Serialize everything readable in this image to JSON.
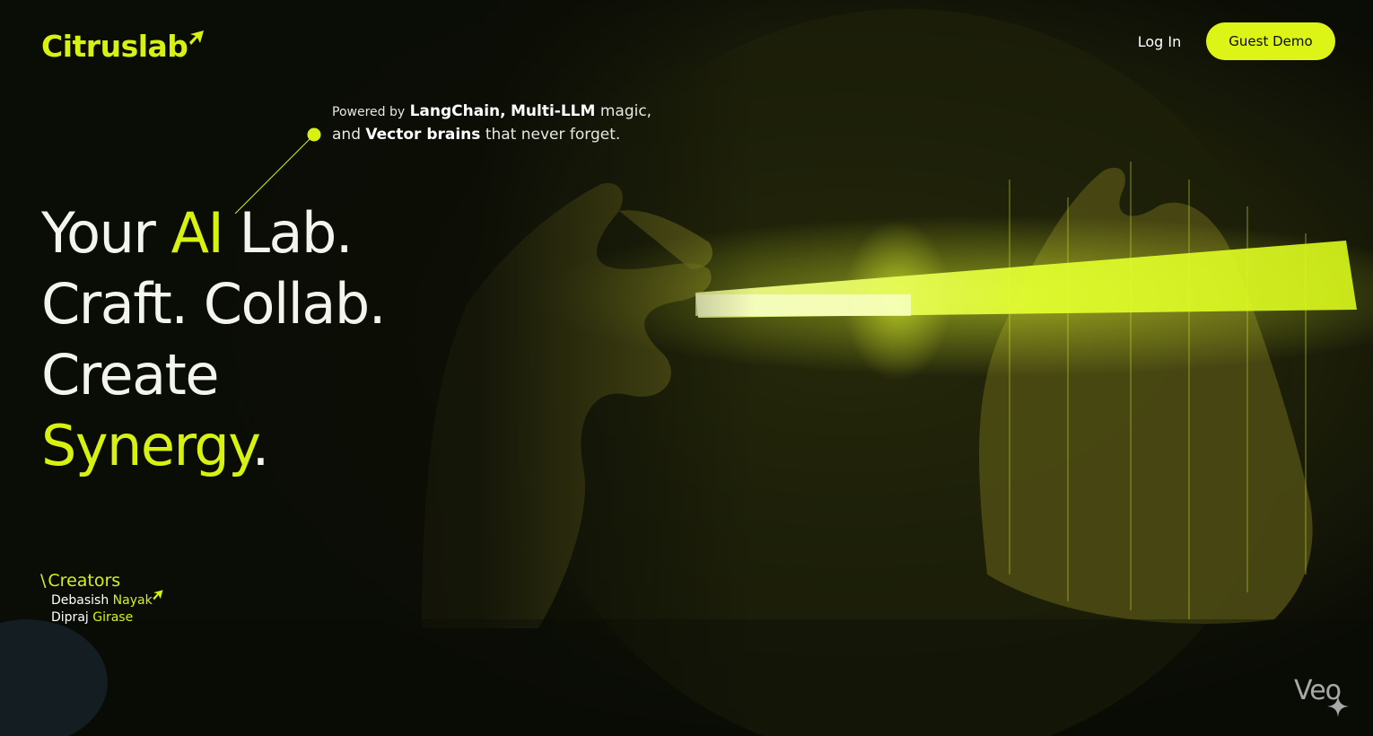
{
  "brand": {
    "name": "Citruslab",
    "accent_color": "#d7f20f",
    "logo_mark_icon": "citrus-slash-icon"
  },
  "nav": {
    "login_label": "Log In",
    "demo_label": "Guest Demo"
  },
  "tagline": {
    "prefix": "Powered by",
    "tech1": "LangChain,",
    "tech2": "Multi-LLM",
    "mid1": "magic,",
    "mid2": "and",
    "tech3": "Vector brains",
    "suffix": "that never forget."
  },
  "headline": {
    "line1_a": "Your",
    "line1_accent": "AI",
    "line1_b": "Lab.",
    "line2": "Craft. Collab.",
    "line3": "Create",
    "line4_accent": "Synergy",
    "line4_end": "."
  },
  "creators": {
    "title": "Creators",
    "people": [
      {
        "first": "Debasish",
        "last": "Nayak"
      },
      {
        "first": "Dipraj",
        "last": "Girase"
      }
    ]
  },
  "watermark": {
    "text": "Veo",
    "icon": "sparkle-icon"
  }
}
